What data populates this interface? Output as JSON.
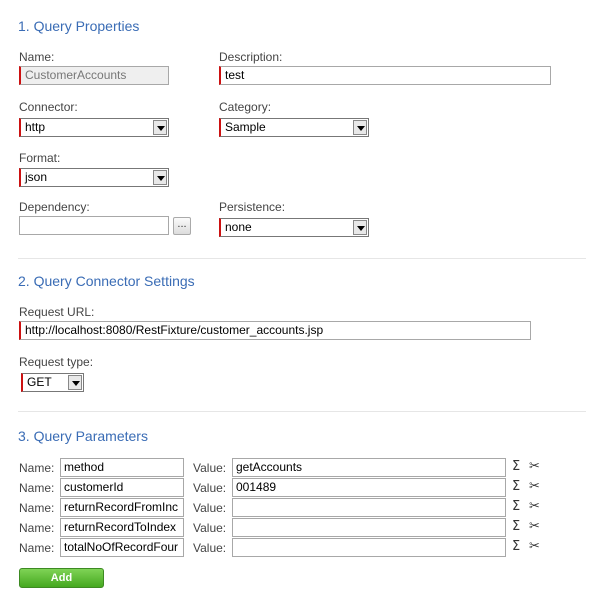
{
  "section1": {
    "title": "1. Query Properties",
    "name_label": "Name:",
    "name_value": "CustomerAccounts",
    "description_label": "Description:",
    "description_value": "test",
    "connector_label": "Connector:",
    "connector_value": "http",
    "category_label": "Category:",
    "category_value": "Sample",
    "format_label": "Format:",
    "format_value": "json",
    "dependency_label": "Dependency:",
    "dependency_value": "",
    "dependency_button": "...",
    "persistence_label": "Persistence:",
    "persistence_value": "none"
  },
  "section2": {
    "title": "2. Query Connector Settings",
    "url_label": "Request URL:",
    "url_value": "http://localhost:8080/RestFixture/customer_accounts.jsp",
    "type_label": "Request type:",
    "type_value": "GET"
  },
  "section3": {
    "title": "3. Query Parameters",
    "name_label": "Name:",
    "value_label": "Value:",
    "params": [
      {
        "name": "method",
        "value": "getAccounts"
      },
      {
        "name": "customerId",
        "value": "001489"
      },
      {
        "name": "returnRecordFromInc",
        "value": ""
      },
      {
        "name": "returnRecordToIndex",
        "value": ""
      },
      {
        "name": "totalNoOfRecordFour",
        "value": ""
      }
    ],
    "add_button": "Add"
  },
  "icons": {
    "sigma": "sigma-icon",
    "scissors": "scissors-icon"
  },
  "colors": {
    "section_title": "#3a6cb5",
    "required_marker": "#cc1111",
    "add_button": "#45a81f"
  }
}
